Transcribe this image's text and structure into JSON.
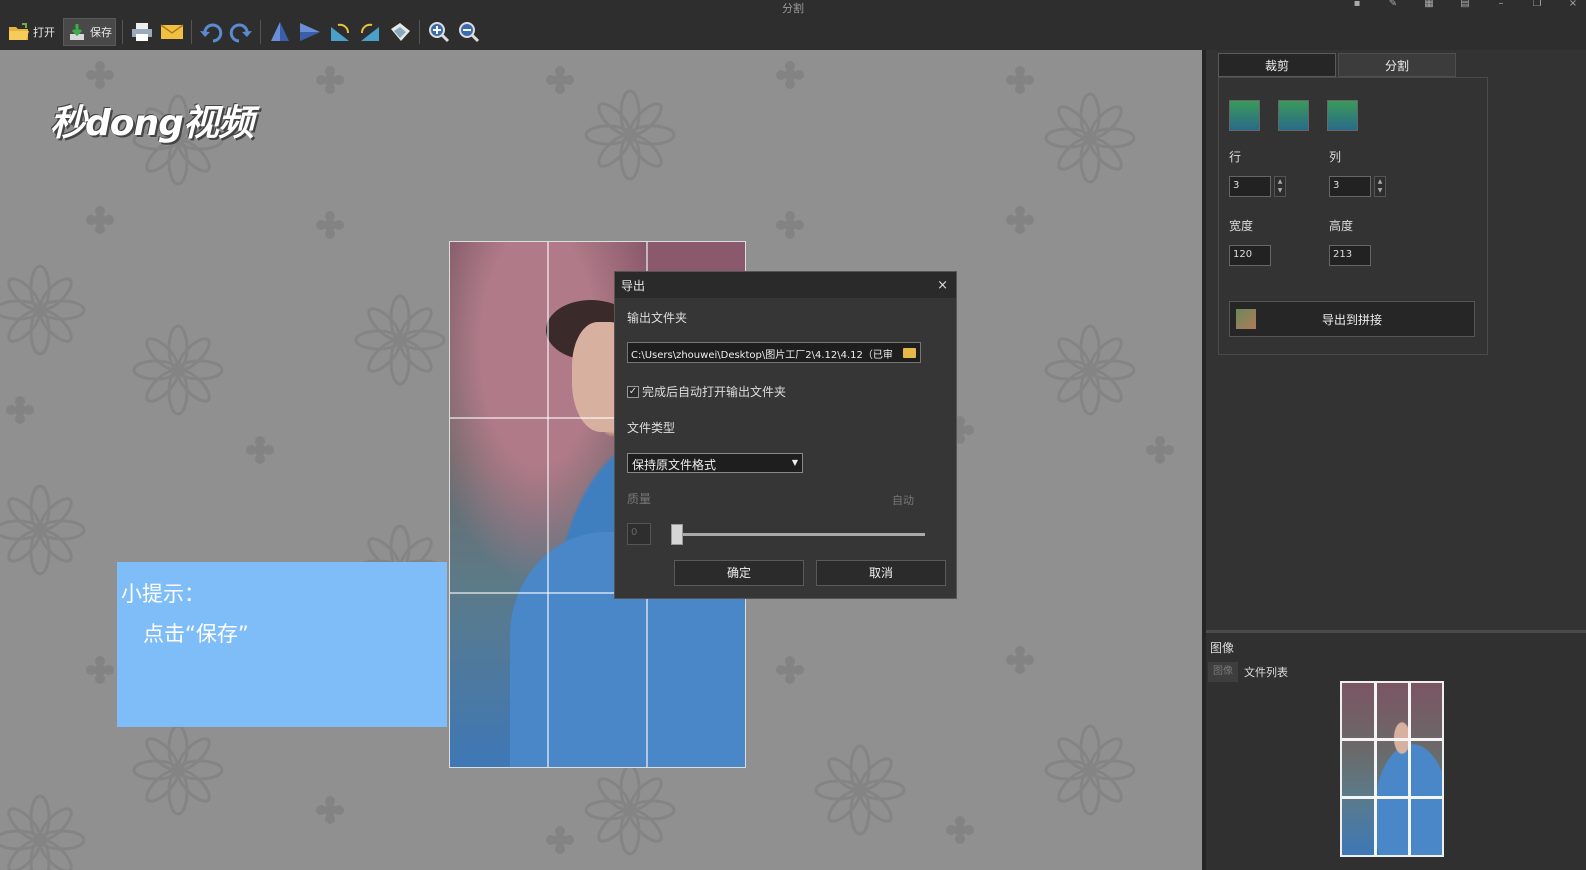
{
  "window": {
    "title": "分割"
  },
  "toolbar": {
    "open_label": "打开",
    "save_label": "保存"
  },
  "watermark": "秒dong视频",
  "tip": {
    "line1": "小提示：",
    "line2": "点击“保存”"
  },
  "dialog": {
    "title": "导出",
    "close": "×",
    "output_folder_label": "输出文件夹",
    "output_folder_value": "C:\\Users\\zhouwei\\Desktop\\图片工厂2\\4.12\\4.12（已审",
    "auto_open_label": "完成后自动打开输出文件夹",
    "auto_open_checked": true,
    "file_type_label": "文件类型",
    "file_type_value": "保持原文件格式",
    "quality_label": "质量",
    "quality_auto_label": "自动",
    "quality_value": "0",
    "ok_label": "确定",
    "cancel_label": "取消"
  },
  "panel": {
    "tabs": [
      {
        "label": "裁剪",
        "active": true
      },
      {
        "label": "分割",
        "active": false
      }
    ],
    "rows_label": "行",
    "rows_value": "3",
    "cols_label": "列",
    "cols_value": "3",
    "width_label": "宽度",
    "width_value": "120",
    "height_label": "高度",
    "height_value": "213",
    "export_label": "导出到拼接"
  },
  "image_pane": {
    "title": "图像",
    "tab_image": "图像",
    "tab_filelist": "文件列表"
  },
  "colors": {
    "tip_bg": "#7fbdf8",
    "canvas_bg": "#909090",
    "dialog_bg": "#363636"
  }
}
